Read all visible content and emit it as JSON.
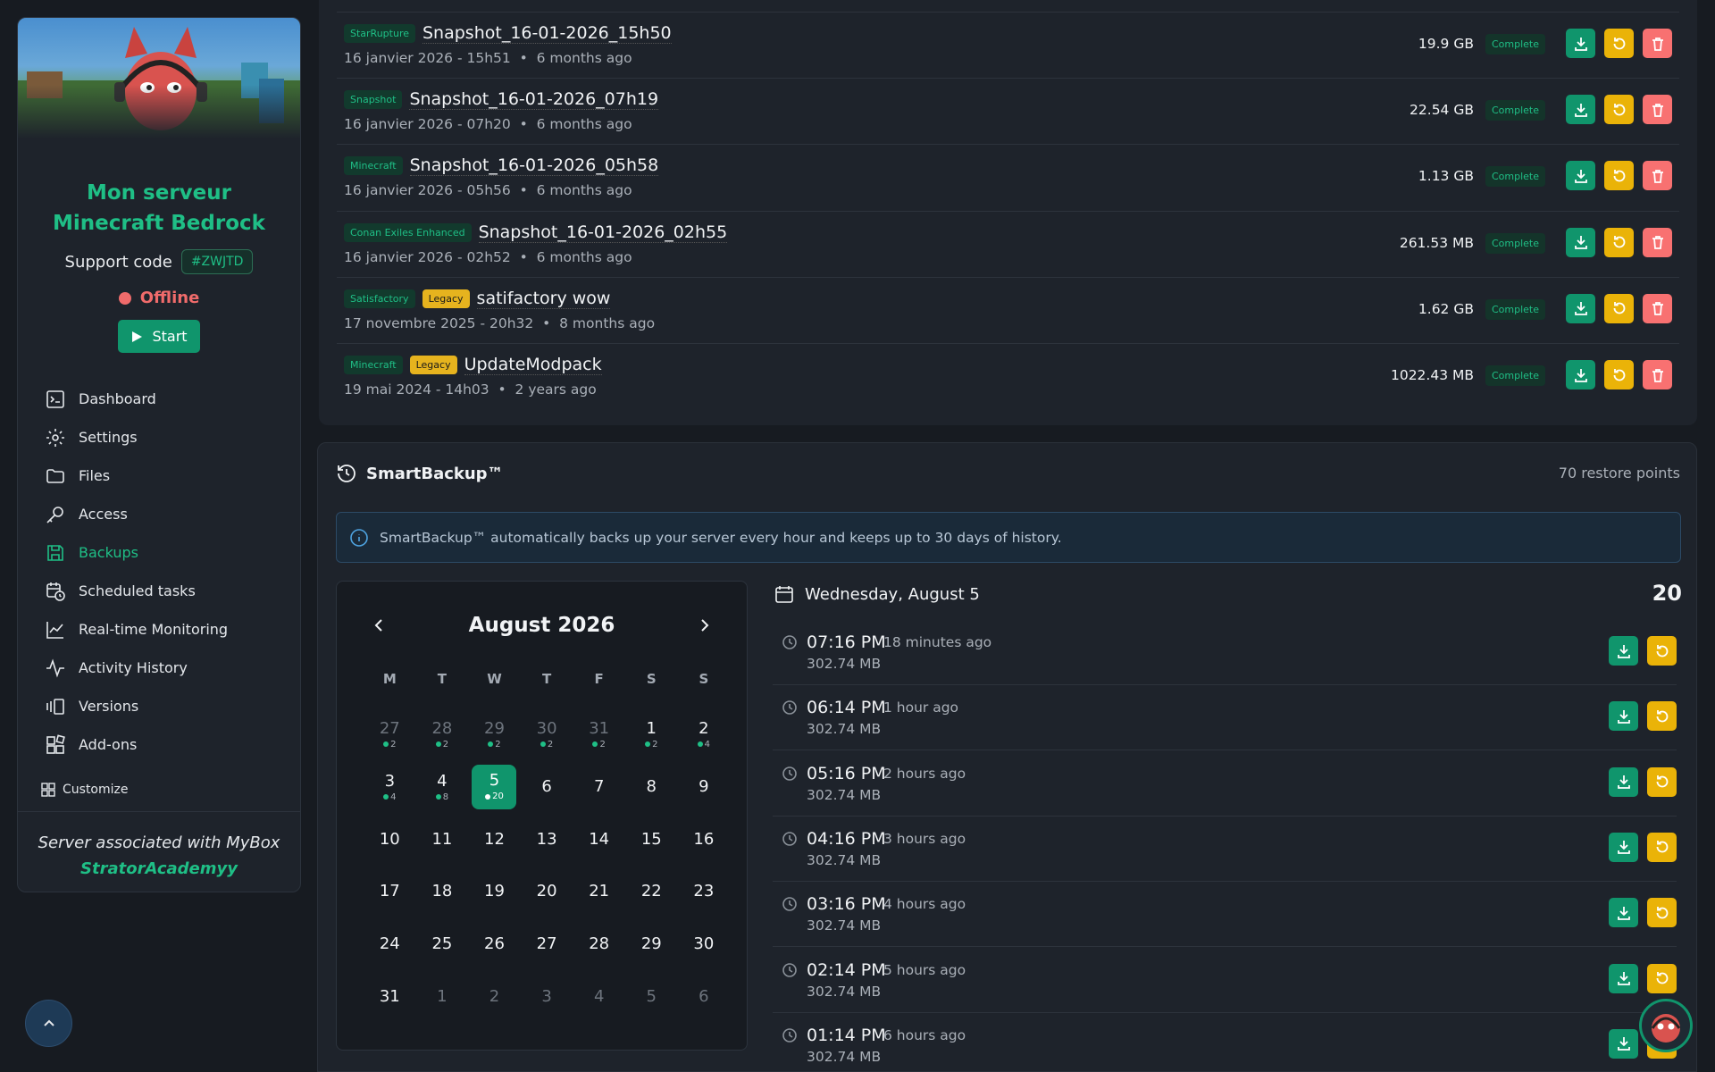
{
  "sidebar": {
    "server_name": "Mon serveur Minecraft Bedrock",
    "support_label": "Support code",
    "support_code": "#ZWJTD",
    "status": "Offline",
    "start_label": "Start",
    "nav": [
      {
        "label": "Dashboard",
        "icon": "terminal-icon"
      },
      {
        "label": "Settings",
        "icon": "gear-icon"
      },
      {
        "label": "Files",
        "icon": "folder-icon"
      },
      {
        "label": "Access",
        "icon": "key-icon"
      },
      {
        "label": "Backups",
        "icon": "save-icon",
        "active": true
      },
      {
        "label": "Scheduled tasks",
        "icon": "calendar-clock-icon"
      },
      {
        "label": "Real-time Monitoring",
        "icon": "chart-line-icon"
      },
      {
        "label": "Activity History",
        "icon": "activity-icon"
      },
      {
        "label": "Versions",
        "icon": "versions-icon"
      },
      {
        "label": "Add-ons",
        "icon": "addons-icon"
      }
    ],
    "customize_label": "Customize",
    "footer_text": "Server associated with MyBox",
    "footer_link": "StratorAcademyy"
  },
  "snapshots": [
    {
      "tag": "StarRupture",
      "legacy": "",
      "name": "Snapshot_16-01-2026_15h50",
      "date": "16 janvier 2026 - 15h51",
      "ago": "6 months ago",
      "size": "19.9 GB",
      "status": "Complete"
    },
    {
      "tag": "Snapshot",
      "legacy": "",
      "name": "Snapshot_16-01-2026_07h19",
      "date": "16 janvier 2026 - 07h20",
      "ago": "6 months ago",
      "size": "22.54 GB",
      "status": "Complete"
    },
    {
      "tag": "Minecraft",
      "legacy": "",
      "name": "Snapshot_16-01-2026_05h58",
      "date": "16 janvier 2026 - 05h56",
      "ago": "6 months ago",
      "size": "1.13 GB",
      "status": "Complete"
    },
    {
      "tag": "Conan Exiles Enhanced",
      "legacy": "",
      "name": "Snapshot_16-01-2026_02h55",
      "date": "16 janvier 2026 - 02h52",
      "ago": "6 months ago",
      "size": "261.53 MB",
      "status": "Complete"
    },
    {
      "tag": "Satisfactory",
      "legacy": "Legacy",
      "name": "satifactory wow",
      "date": "17 novembre 2025 - 20h32",
      "ago": "8 months ago",
      "size": "1.62 GB",
      "status": "Complete"
    },
    {
      "tag": "Minecraft",
      "legacy": "Legacy",
      "name": "UpdateModpack",
      "date": "19 mai 2024 - 14h03",
      "ago": "2 years ago",
      "size": "1022.43 MB",
      "status": "Complete"
    }
  ],
  "smart": {
    "title": "SmartBackup™",
    "restore_points": "70 restore points",
    "info": "SmartBackup™ automatically backs up your server every hour and keeps up to 30 days of history."
  },
  "calendar": {
    "month": "August 2026",
    "dow": [
      "M",
      "T",
      "W",
      "T",
      "F",
      "S",
      "S"
    ],
    "days": [
      {
        "n": "27",
        "c": "2",
        "m": true
      },
      {
        "n": "28",
        "c": "2",
        "m": true
      },
      {
        "n": "29",
        "c": "2",
        "m": true
      },
      {
        "n": "30",
        "c": "2",
        "m": true
      },
      {
        "n": "31",
        "c": "2",
        "m": true
      },
      {
        "n": "1",
        "c": "2"
      },
      {
        "n": "2",
        "c": "4"
      },
      {
        "n": "3",
        "c": "4"
      },
      {
        "n": "4",
        "c": "8"
      },
      {
        "n": "5",
        "c": "20",
        "sel": true
      },
      {
        "n": "6"
      },
      {
        "n": "7"
      },
      {
        "n": "8"
      },
      {
        "n": "9"
      },
      {
        "n": "10"
      },
      {
        "n": "11"
      },
      {
        "n": "12"
      },
      {
        "n": "13"
      },
      {
        "n": "14"
      },
      {
        "n": "15"
      },
      {
        "n": "16"
      },
      {
        "n": "17"
      },
      {
        "n": "18"
      },
      {
        "n": "19"
      },
      {
        "n": "20"
      },
      {
        "n": "21"
      },
      {
        "n": "22"
      },
      {
        "n": "23"
      },
      {
        "n": "24"
      },
      {
        "n": "25"
      },
      {
        "n": "26"
      },
      {
        "n": "27"
      },
      {
        "n": "28"
      },
      {
        "n": "29"
      },
      {
        "n": "30"
      },
      {
        "n": "31"
      },
      {
        "n": "1",
        "m": true
      },
      {
        "n": "2",
        "m": true
      },
      {
        "n": "3",
        "m": true
      },
      {
        "n": "4",
        "m": true
      },
      {
        "n": "5",
        "m": true
      },
      {
        "n": "6",
        "m": true
      }
    ]
  },
  "day": {
    "title": "Wednesday, August 5",
    "count": "20",
    "points": [
      {
        "time": "07:16 PM",
        "ago": "18 minutes ago",
        "size": "302.74 MB"
      },
      {
        "time": "06:14 PM",
        "ago": "1 hour ago",
        "size": "302.74 MB"
      },
      {
        "time": "05:16 PM",
        "ago": "2 hours ago",
        "size": "302.74 MB"
      },
      {
        "time": "04:16 PM",
        "ago": "3 hours ago",
        "size": "302.74 MB"
      },
      {
        "time": "03:16 PM",
        "ago": "4 hours ago",
        "size": "302.74 MB"
      },
      {
        "time": "02:14 PM",
        "ago": "5 hours ago",
        "size": "302.74 MB"
      },
      {
        "time": "01:14 PM",
        "ago": "6 hours ago",
        "size": "302.74 MB"
      }
    ]
  },
  "colors": {
    "accent": "#10956c",
    "accent_text": "#1fbf86",
    "restore": "#eab308",
    "delete": "#f87171",
    "offline": "#f06b6b",
    "bg": "#171b21",
    "panel": "#1e232b"
  }
}
